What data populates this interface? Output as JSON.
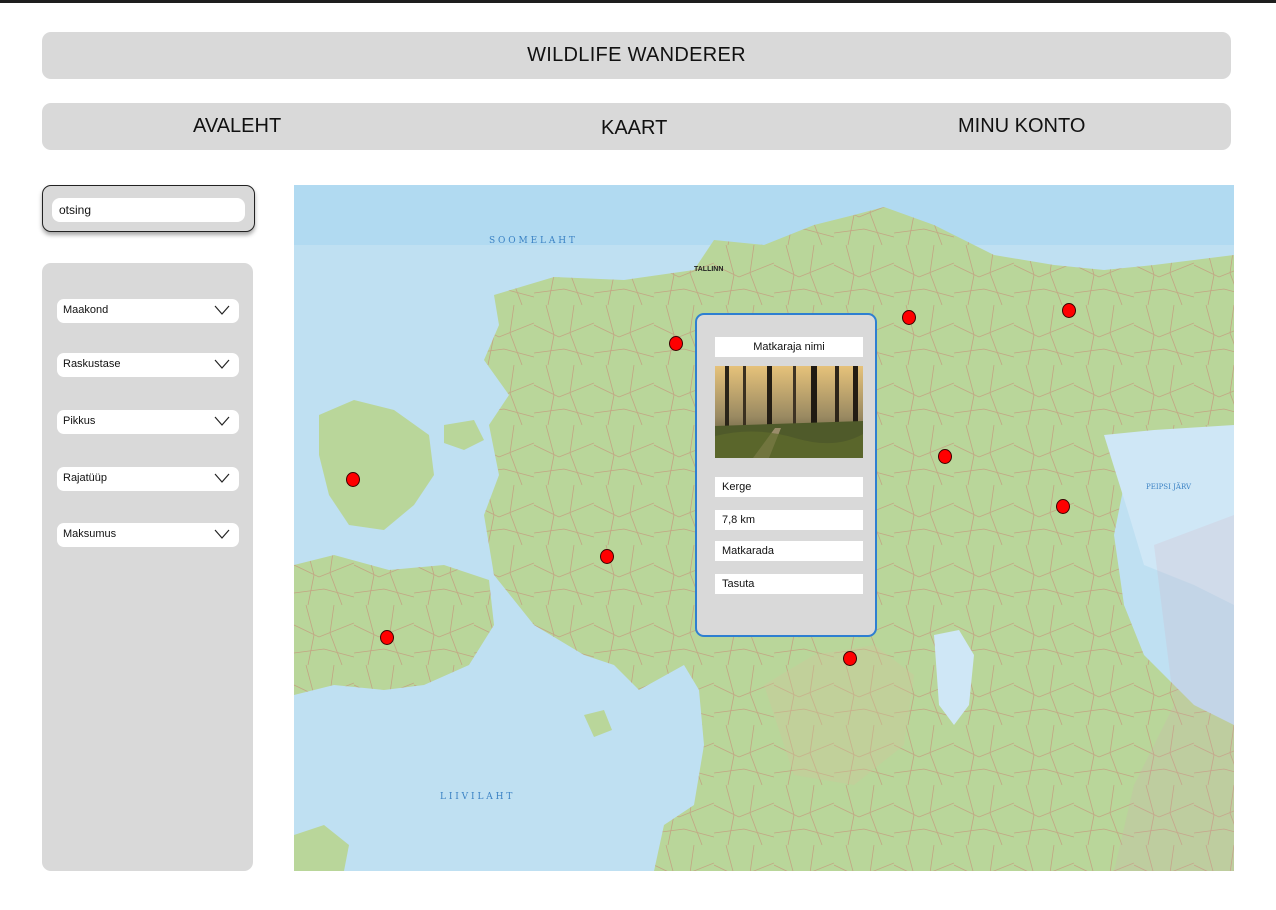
{
  "app": {
    "title": "WILDLIFE WANDERER"
  },
  "nav": {
    "items": [
      {
        "label": "AVALEHT"
      },
      {
        "label": "KAART"
      },
      {
        "label": "MINU KONTO"
      }
    ]
  },
  "search": {
    "placeholder": "otsing"
  },
  "filters": [
    {
      "label": "Maakond",
      "icon": "chevron-down-icon"
    },
    {
      "label": "Raskustase",
      "icon": "chevron-down-icon"
    },
    {
      "label": "Pikkus",
      "icon": "chevron-down-icon"
    },
    {
      "label": "Rajatüüp",
      "icon": "chevron-down-icon"
    },
    {
      "label": "Maksumus",
      "icon": "chevron-down-icon"
    }
  ],
  "map": {
    "labels": {
      "gulf_finland": "S O O M E   L A H T",
      "tallinn": "TALLINN",
      "peipsi": "PEIPSI JÄRV",
      "liivi": "L I I V I   L A H T"
    },
    "marker_color": "#ff0000",
    "marker_count": 10
  },
  "popup": {
    "name": "Matkaraja nimi",
    "difficulty": "Kerge",
    "length": "7,8 km",
    "trail_type": "Matkarada",
    "cost": "Tasuta",
    "image_icon": "forest-boardwalk-photo",
    "accent": "#2e7fd1"
  },
  "colors": {
    "panel": "#d9d9d9",
    "sea": "#bfe0f2",
    "land": "#b9d69a"
  }
}
